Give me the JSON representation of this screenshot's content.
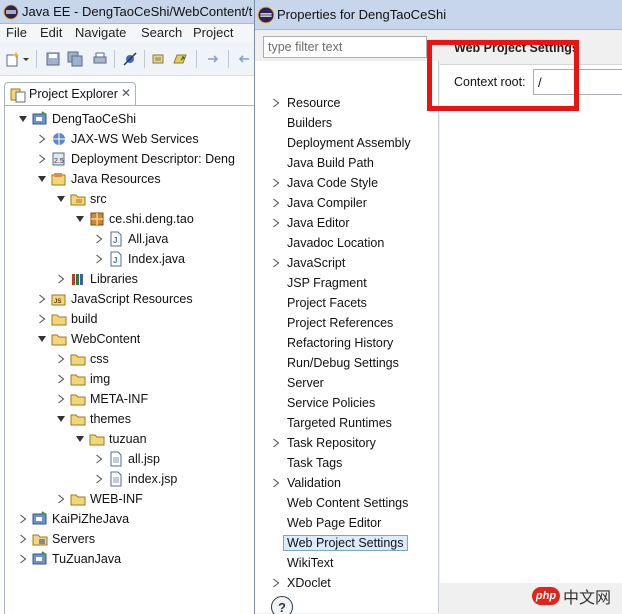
{
  "eclipse": {
    "title": "Java EE - DengTaoCeShi/WebContent/t",
    "menu": [
      "File",
      "Edit",
      "Navigate",
      "Search",
      "Project"
    ],
    "explorer_tab": "Project Explorer",
    "tree": [
      {
        "label": "DengTaoCeShi",
        "icon": "project-icon",
        "expanded": true
      },
      {
        "label": "JAX-WS Web Services",
        "icon": "webservice-icon",
        "expanded": false
      },
      {
        "label": "Deployment Descriptor: Deng",
        "icon": "deployment-descriptor-icon",
        "expanded": false
      },
      {
        "label": "Java Resources",
        "icon": "java-resources-icon",
        "expanded": true
      },
      {
        "label": "src",
        "icon": "source-folder-icon",
        "expanded": true
      },
      {
        "label": "ce.shi.deng.tao",
        "icon": "package-icon",
        "expanded": true
      },
      {
        "label": "All.java",
        "icon": "java-file-icon",
        "expanded": false
      },
      {
        "label": "Index.java",
        "icon": "java-file-icon",
        "expanded": false
      },
      {
        "label": "Libraries",
        "icon": "libraries-icon",
        "expanded": false
      },
      {
        "label": "JavaScript Resources",
        "icon": "js-resources-icon",
        "expanded": false
      },
      {
        "label": "build",
        "icon": "folder-icon",
        "expanded": false
      },
      {
        "label": "WebContent",
        "icon": "folder-icon",
        "expanded": true
      },
      {
        "label": "css",
        "icon": "folder-icon",
        "expanded": false
      },
      {
        "label": "img",
        "icon": "folder-icon",
        "expanded": false
      },
      {
        "label": "META-INF",
        "icon": "folder-icon",
        "expanded": false
      },
      {
        "label": "themes",
        "icon": "folder-icon",
        "expanded": true
      },
      {
        "label": "tuzuan",
        "icon": "folder-icon",
        "expanded": true
      },
      {
        "label": "all.jsp",
        "icon": "jsp-file-icon",
        "expanded": false
      },
      {
        "label": "index.jsp",
        "icon": "jsp-file-icon",
        "expanded": false
      },
      {
        "label": "WEB-INF",
        "icon": "folder-icon",
        "expanded": false
      },
      {
        "label": "KaiPiZheJava",
        "icon": "project-icon",
        "expanded": false
      },
      {
        "label": "Servers",
        "icon": "servers-folder-icon",
        "expanded": false
      },
      {
        "label": "TuZuanJava",
        "icon": "project-icon",
        "expanded": false
      }
    ]
  },
  "dialog": {
    "title": "Properties for DengTaoCeShi",
    "filter_placeholder": "type filter text",
    "nav": [
      {
        "label": "Resource",
        "expandable": true
      },
      {
        "label": "Builders",
        "expandable": false
      },
      {
        "label": "Deployment Assembly",
        "expandable": false
      },
      {
        "label": "Java Build Path",
        "expandable": false
      },
      {
        "label": "Java Code Style",
        "expandable": true
      },
      {
        "label": "Java Compiler",
        "expandable": true
      },
      {
        "label": "Java Editor",
        "expandable": true
      },
      {
        "label": "Javadoc Location",
        "expandable": false
      },
      {
        "label": "JavaScript",
        "expandable": true
      },
      {
        "label": "JSP Fragment",
        "expandable": false
      },
      {
        "label": "Project Facets",
        "expandable": false
      },
      {
        "label": "Project References",
        "expandable": false
      },
      {
        "label": "Refactoring History",
        "expandable": false
      },
      {
        "label": "Run/Debug Settings",
        "expandable": false
      },
      {
        "label": "Server",
        "expandable": false
      },
      {
        "label": "Service Policies",
        "expandable": false
      },
      {
        "label": "Targeted Runtimes",
        "expandable": false
      },
      {
        "label": "Task Repository",
        "expandable": true
      },
      {
        "label": "Task Tags",
        "expandable": false
      },
      {
        "label": "Validation",
        "expandable": true
      },
      {
        "label": "Web Content Settings",
        "expandable": false
      },
      {
        "label": "Web Page Editor",
        "expandable": false
      },
      {
        "label": "Web Project Settings",
        "expandable": false,
        "selected": true
      },
      {
        "label": "WikiText",
        "expandable": false
      },
      {
        "label": "XDoclet",
        "expandable": true
      }
    ],
    "page_title": "Web Project Settings",
    "context_root_label": "Context root:",
    "context_root_value": "/",
    "help_label": "?"
  },
  "watermark": {
    "logo": "php",
    "text": "中文网"
  },
  "colors": {
    "highlight": "#ee1111",
    "selection": "#dcebfc",
    "title_bar": "#c7d6ea"
  }
}
